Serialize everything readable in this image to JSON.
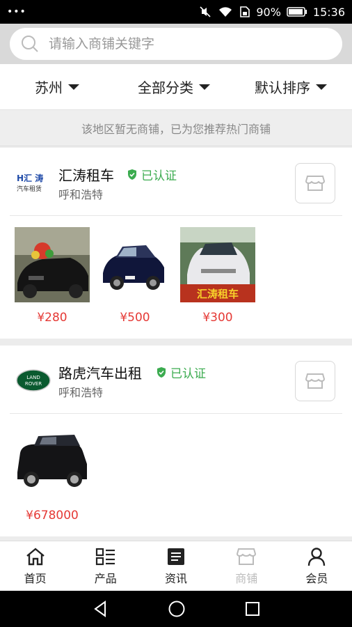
{
  "status": {
    "battery": "90%",
    "time": "15:36"
  },
  "search": {
    "placeholder": "请输入商铺关键字"
  },
  "filters": [
    {
      "label": "苏州"
    },
    {
      "label": "全部分类"
    },
    {
      "label": "默认排序"
    }
  ],
  "notice": "该地区暂无商铺，已为您推荐热门商铺",
  "shops": [
    {
      "name": "汇涛租车",
      "verified": "已认证",
      "city": "呼和浩特",
      "logo_text": [
        "H汇 涛",
        "汽车租赁"
      ],
      "products": [
        {
          "price": "¥280",
          "image": "black-sedan-wedding"
        },
        {
          "price": "¥500",
          "image": "dark-blue-suv"
        },
        {
          "price": "¥300",
          "image": "white-sedan-banner",
          "banner": "汇涛租车"
        }
      ]
    },
    {
      "name": "路虎汽车出租",
      "verified": "已认证",
      "city": "呼和浩特",
      "logo_text": [
        "LAND",
        "ROVER"
      ],
      "products": [
        {
          "price": "¥678000",
          "image": "black-land-rover"
        }
      ]
    }
  ],
  "tabs": [
    {
      "label": "首页",
      "icon": "home-icon"
    },
    {
      "label": "产品",
      "icon": "list-icon"
    },
    {
      "label": "资讯",
      "icon": "news-icon"
    },
    {
      "label": "商铺",
      "icon": "store-icon",
      "active": false
    },
    {
      "label": "会员",
      "icon": "user-icon"
    }
  ],
  "colors": {
    "accent_green": "#3bab4f",
    "price_red": "#e53935"
  }
}
